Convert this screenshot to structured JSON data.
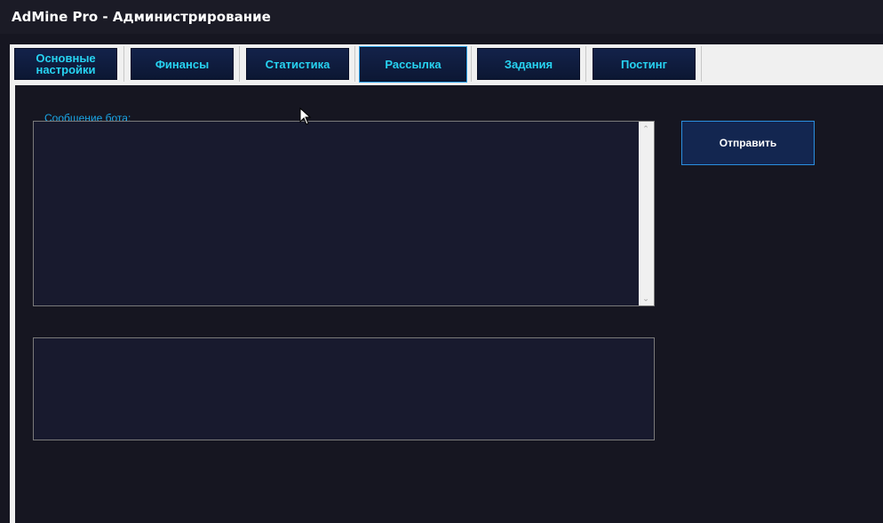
{
  "window": {
    "title": "AdMine Pro - Администрирование"
  },
  "tabs": [
    {
      "label": "Основные настройки"
    },
    {
      "label": "Финансы"
    },
    {
      "label": "Статистика"
    },
    {
      "label": "Рассылка"
    },
    {
      "label": "Задания"
    },
    {
      "label": "Постинг"
    }
  ],
  "broadcast": {
    "message_label": "Сообщение бота:",
    "message_value": "",
    "secondary_value": "",
    "send_label": "Отправить"
  },
  "colors": {
    "accent": "#27d3f2",
    "button_border": "#2b8fe0",
    "background": "#161621"
  }
}
